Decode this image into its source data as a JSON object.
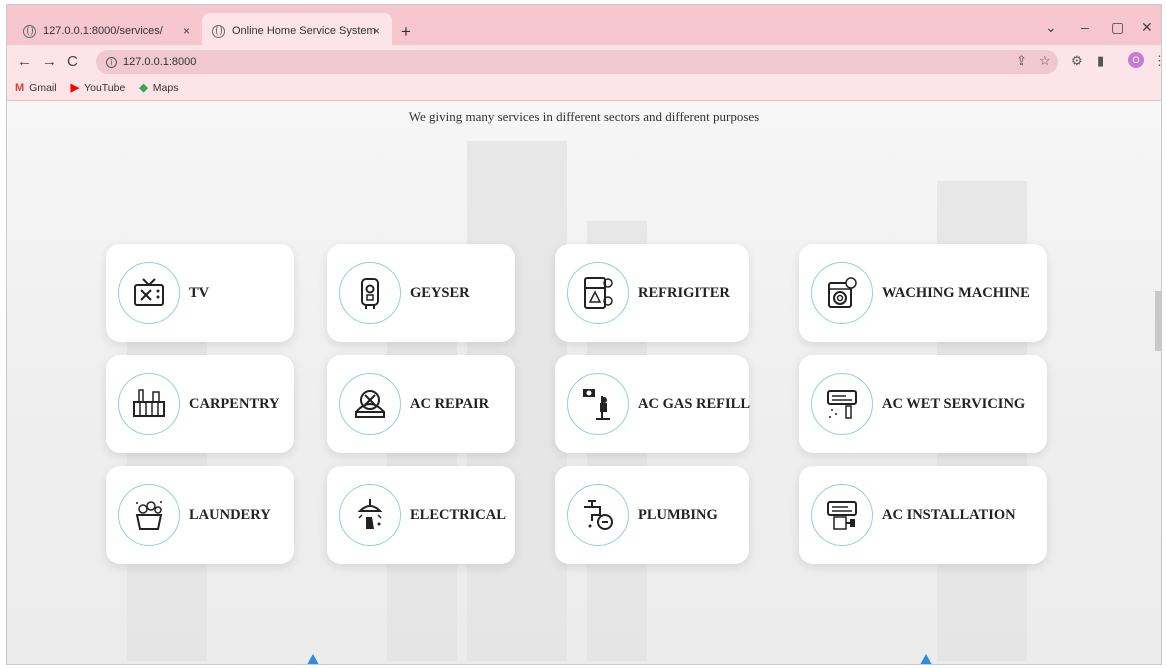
{
  "browser": {
    "tabs": [
      {
        "title": "127.0.0.1:8000/services/",
        "close": "×"
      },
      {
        "title": "Online Home Service System",
        "close": "×"
      }
    ],
    "new_tab": "+",
    "address": "127.0.0.1:8000",
    "profile_initial": "O",
    "bookmarks": [
      {
        "icon": "gmail-icon",
        "label": "Gmail"
      },
      {
        "icon": "youtube-icon",
        "label": "YouTube"
      },
      {
        "icon": "maps-icon",
        "label": "Maps"
      }
    ]
  },
  "page": {
    "intro": "We giving many services in different sectors and different purposes",
    "services": [
      {
        "label": "TV",
        "icon": "tv-icon"
      },
      {
        "label": "GEYSER",
        "icon": "geyser-icon"
      },
      {
        "label": "REFRIGITER",
        "icon": "refrigerator-icon"
      },
      {
        "label": "WACHING MACHINE",
        "icon": "washing-machine-icon"
      },
      {
        "label": "CARPENTRY",
        "icon": "carpentry-icon"
      },
      {
        "label": "AC REPAIR",
        "icon": "ac-repair-icon"
      },
      {
        "label": "AC GAS REFILL",
        "icon": "ac-gas-refill-icon"
      },
      {
        "label": "AC WET SERVICING",
        "icon": "ac-wet-servicing-icon"
      },
      {
        "label": "LAUNDERY",
        "icon": "laundry-icon"
      },
      {
        "label": "ELECTRICAL",
        "icon": "electrical-icon"
      },
      {
        "label": "PLUMBING",
        "icon": "plumbing-icon"
      },
      {
        "label": "AC INSTALLATION",
        "icon": "ac-installation-icon"
      }
    ]
  },
  "colors": {
    "tabstrip": "#f6c7cf",
    "toolbar": "#fce4e8",
    "icon_ring": "#8ed0de",
    "accent_arrow": "#2a8fd8"
  }
}
